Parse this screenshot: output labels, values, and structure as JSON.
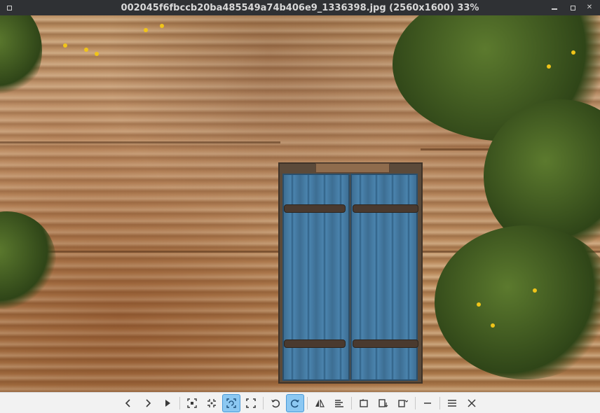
{
  "window": {
    "title": "002045f6fbccb20ba485549a74b406e9_1336398.jpg (2560x1600) 33%"
  },
  "toolbar": {
    "buttons": [
      {
        "name": "previous-image-button",
        "icon": "chevron-left-icon",
        "glyph": "‹",
        "active": false
      },
      {
        "name": "next-image-button",
        "icon": "chevron-right-icon",
        "glyph": "›",
        "active": false
      },
      {
        "name": "slideshow-button",
        "icon": "play-icon",
        "glyph": "▶",
        "active": false
      },
      {
        "name": "zoom-fit-button",
        "icon": "fit-window-icon",
        "glyph": "",
        "active": false
      },
      {
        "name": "zoom-original-button",
        "icon": "original-size-icon",
        "glyph": "",
        "active": false
      },
      {
        "name": "zoom-auto-button",
        "icon": "auto-zoom-icon",
        "glyph": "",
        "active": true
      },
      {
        "name": "fullscreen-button",
        "icon": "fullscreen-icon",
        "glyph": "",
        "active": false
      },
      {
        "name": "rotate-left-button",
        "icon": "rotate-ccw-icon",
        "glyph": "↺",
        "active": false
      },
      {
        "name": "rotate-right-button",
        "icon": "rotate-cw-icon",
        "glyph": "↻",
        "active": true
      },
      {
        "name": "flip-horizontal-button",
        "icon": "flip-icon",
        "glyph": "",
        "active": false
      },
      {
        "name": "flip-vertical-button",
        "icon": "align-icon",
        "glyph": "",
        "active": false
      },
      {
        "name": "open-file-button",
        "icon": "file-open-icon",
        "glyph": "",
        "active": false
      },
      {
        "name": "save-file-button",
        "icon": "file-save-icon",
        "glyph": "",
        "active": false
      },
      {
        "name": "file-menu-button",
        "icon": "file-menu-icon",
        "glyph": "",
        "active": false
      },
      {
        "name": "minimize-toolbar-button",
        "icon": "minus-icon",
        "glyph": "—",
        "active": false
      },
      {
        "name": "menu-button",
        "icon": "hamburger-icon",
        "glyph": "≡",
        "active": false
      },
      {
        "name": "close-button",
        "icon": "close-icon",
        "glyph": "✕",
        "active": false
      }
    ]
  }
}
